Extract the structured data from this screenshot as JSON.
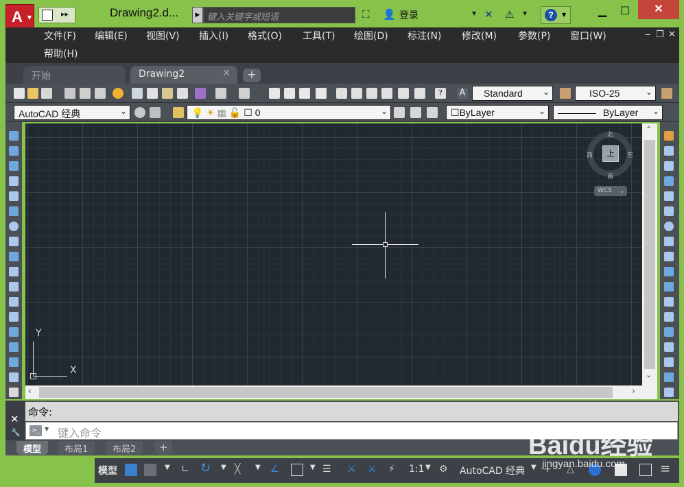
{
  "titlebar": {
    "app_letter": "A",
    "document_title": "Drawing2.d...",
    "search_placeholder": "键入关键字或短语",
    "login_label": "登录"
  },
  "menubar": {
    "items": [
      "文件(F)",
      "编辑(E)",
      "视图(V)",
      "插入(I)",
      "格式(O)",
      "工具(T)",
      "绘图(D)",
      "标注(N)",
      "修改(M)",
      "参数(P)",
      "窗口(W)",
      "帮助(H)"
    ]
  },
  "tabs": {
    "start": "开始",
    "active": "Drawing2"
  },
  "toolbar1": {
    "text_style": "Standard",
    "dim_style": "ISO-25"
  },
  "toolbar2": {
    "workspace": "AutoCAD 经典",
    "layer": "0",
    "color": "ByLayer",
    "linetype": "ByLayer"
  },
  "viewcube": {
    "north": "北",
    "south": "南",
    "east": "东",
    "west": "西",
    "top": "上",
    "wcs": "WCS"
  },
  "ucs": {
    "x": "X",
    "y": "Y"
  },
  "command": {
    "history": "命令:",
    "placeholder": "键入命令"
  },
  "layout_tabs": {
    "model": "模型",
    "layout1": "布局1",
    "layout2": "布局2"
  },
  "statusbar": {
    "model": "模型",
    "scale": "1:1",
    "workspace": "AutoCAD 经典"
  },
  "watermark": {
    "brand": "Baidu经验",
    "url": "jingyan.baidu.com"
  }
}
